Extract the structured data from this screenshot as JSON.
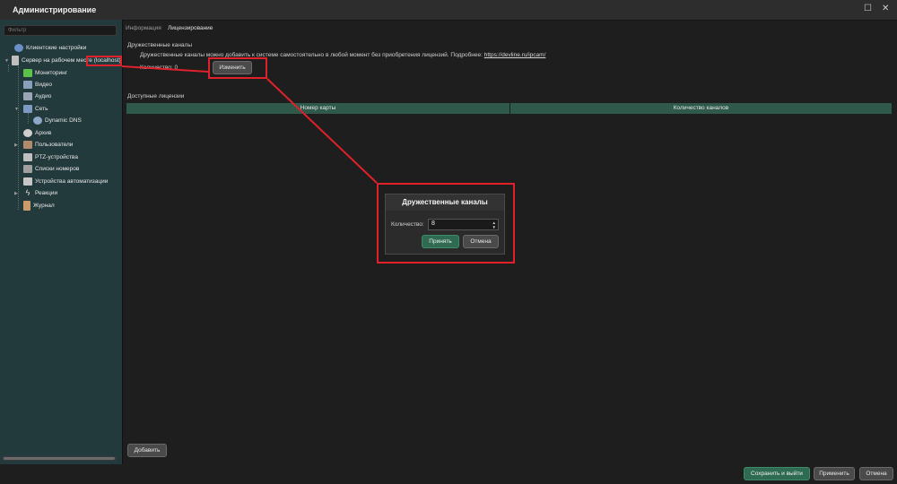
{
  "window": {
    "title": "Администрирование",
    "maximize_glyph": "☐",
    "close_glyph": "✕"
  },
  "sidebar": {
    "filter_placeholder": "Фильтр",
    "items": [
      {
        "label": "Клиентские настройки",
        "icon": "client-settings-icon",
        "color": "#6b8fc7"
      },
      {
        "label": "Сервер на рабочем месте (localhost)",
        "icon": "server-icon",
        "color": "#bfbfbf"
      },
      {
        "label": "Мониторинг",
        "icon": "monitoring-icon",
        "color": "#5cc24a"
      },
      {
        "label": "Видео",
        "icon": "video-icon",
        "color": "#8aa0b8"
      },
      {
        "label": "Аудио",
        "icon": "audio-icon",
        "color": "#9aa6b4"
      },
      {
        "label": "Сеть",
        "icon": "network-icon",
        "color": "#7d9ac2"
      },
      {
        "label": "Dynamic DNS",
        "icon": "dynamic-dns-icon",
        "color": "#8da7c9"
      },
      {
        "label": "Архив",
        "icon": "archive-icon",
        "color": "#cfcfcf"
      },
      {
        "label": "Пользователи",
        "icon": "users-icon",
        "color": "#b08a6a"
      },
      {
        "label": "PTZ-устройства",
        "icon": "ptz-icon",
        "color": "#bfbfbf"
      },
      {
        "label": "Списки номеров",
        "icon": "plate-lists-icon",
        "color": "#a0a0a0"
      },
      {
        "label": "Устройства автоматизации",
        "icon": "automation-icon",
        "color": "#c7c7c7"
      },
      {
        "label": "Реакции",
        "icon": "reactions-icon",
        "color": "#e0e0e0"
      },
      {
        "label": "Журнал",
        "icon": "journal-icon",
        "color": "#c99a6a"
      }
    ]
  },
  "tabs": [
    {
      "label": "Информация",
      "active": false
    },
    {
      "label": "Лицензирование",
      "active": true
    }
  ],
  "friendly_channels": {
    "title": "Дружественные каналы",
    "description": "Дружественные каналы можно добавить к системе самостоятельно в любой момент без приобретения лицензий. Подробнее:",
    "link": "https://devline.ru/ipcam/",
    "quantity_label": "Количество: 0",
    "change_button": "Изменить"
  },
  "licenses": {
    "title": "Доступные лицензии",
    "columns": [
      "Номер карты",
      "Количество каналов"
    ]
  },
  "dialog": {
    "title": "Дружественные каналы",
    "quantity_label": "Количество:",
    "quantity_value": "8",
    "accept": "Принять",
    "cancel": "Отмена"
  },
  "buttons": {
    "add": "Добавить",
    "save_exit": "Сохранить и выйти",
    "apply": "Применить",
    "cancel": "Отмена"
  },
  "colors": {
    "highlight": "#e0202a",
    "accent_green": "#2e6b52",
    "table_header": "#2f5a4b",
    "sidebar_bg": "#233a3d"
  }
}
